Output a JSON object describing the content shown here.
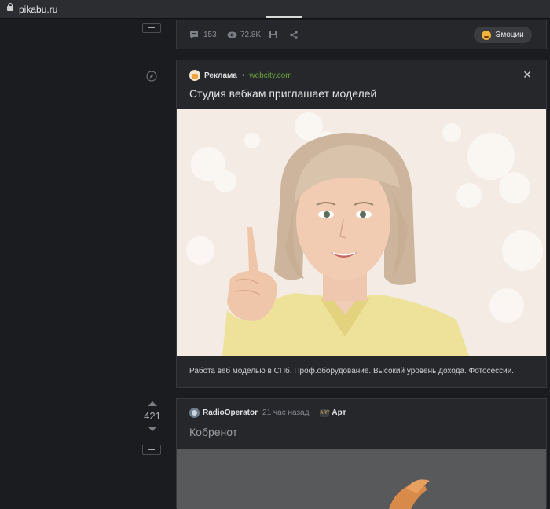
{
  "browser": {
    "url": "pikabu.ru"
  },
  "prev_post": {
    "comments": "153",
    "views": "72.8K",
    "emotions_label": "Эмоции"
  },
  "ad": {
    "label": "Реклама",
    "site": "webcity.com",
    "title": "Студия вебкам приглашает моделей",
    "description": "Работа веб моделью в СПб. Проф.оборудование. Высокий уровень дохода. Фотосессии."
  },
  "post": {
    "rating": "421",
    "author": "RadioOperator",
    "time": "21 час назад",
    "tag": "Арт",
    "tag_icon_text": "ART",
    "title": "Кобренот"
  },
  "colors": {
    "accent_link": "#6ba53b",
    "background": "#1b1c1f",
    "card": "#25272b"
  },
  "icons": [
    "lock-icon",
    "comments-icon",
    "eye-icon",
    "save-icon",
    "share-icon",
    "emoji-icon",
    "compass-icon",
    "close-icon",
    "vote-up-icon",
    "vote-down-icon"
  ]
}
